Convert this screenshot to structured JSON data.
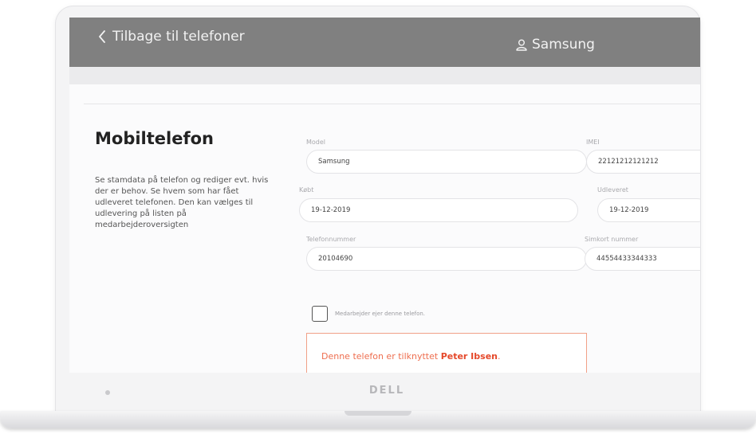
{
  "header": {
    "back_label": "Tilbage til telefoner",
    "user_label": "Samsung"
  },
  "page": {
    "title": "Mobiltelefon",
    "description": "Se stamdata på telefon og rediger evt. hvis der er behov. Se hvem som har fået udleveret telefonen. Den kan vælges til udlevering på listen på medarbejderoversigten"
  },
  "form": {
    "model_label": "Model",
    "model_value": "Samsung",
    "imei_label": "IMEI",
    "imei_value": "22121212121212",
    "bought_label": "Købt",
    "bought_value": "19-12-2019",
    "handed_out_label": "Udleveret",
    "handed_out_value": "19-12-2019",
    "phone_label": "Telefonnummer",
    "phone_value": "20104690",
    "sim_label": "Simkort nummer",
    "sim_value": "44554433344333",
    "owner_checkbox_label": "Medarbejder ejer denne telefon.",
    "owner_checked": false
  },
  "alert": {
    "prefix": "Denne telefon er tilknyttet ",
    "name": "Peter Ibsen",
    "suffix": "."
  },
  "device": {
    "brand": "DELL"
  },
  "colors": {
    "header_bg": "#808080",
    "alert_border": "#f1a088",
    "alert_text": "#ee6e4f",
    "alert_name": "#e5482a"
  },
  "icons": {
    "back": "chevron-left-icon",
    "user": "user-icon"
  }
}
